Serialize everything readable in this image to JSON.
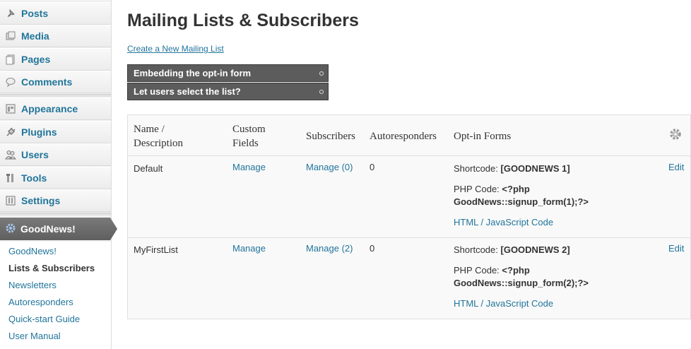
{
  "sidebar": {
    "items": [
      {
        "label": "Posts",
        "icon": "pin-icon"
      },
      {
        "label": "Media",
        "icon": "media-icon"
      },
      {
        "label": "Pages",
        "icon": "pages-icon"
      },
      {
        "label": "Comments",
        "icon": "comments-icon"
      },
      {
        "label": "Appearance",
        "icon": "appearance-icon"
      },
      {
        "label": "Plugins",
        "icon": "plugins-icon"
      },
      {
        "label": "Users",
        "icon": "users-icon"
      },
      {
        "label": "Tools",
        "icon": "tools-icon"
      },
      {
        "label": "Settings",
        "icon": "settings-icon"
      }
    ],
    "active": {
      "label": "GoodNews!",
      "icon": "goodnews-gear-icon"
    },
    "submenu": [
      "GoodNews!",
      "Lists & Subscribers",
      "Newsletters",
      "Autoresponders",
      "Quick-start Guide",
      "User Manual"
    ],
    "current_sub": "Lists & Subscribers"
  },
  "page": {
    "title": "Mailing Lists & Subscribers",
    "create_link": "Create a New Mailing List",
    "help_boxes": [
      "Embedding the opt-in form",
      "Let users select the list?"
    ]
  },
  "table": {
    "headers": {
      "name": [
        "Name /",
        "Description"
      ],
      "fields": [
        "Custom",
        "Fields"
      ],
      "subscribers": "Subscribers",
      "autoresponders": "Autoresponders",
      "optin": "Opt-in Forms"
    },
    "rows": [
      {
        "name": "Default",
        "fields": "Manage",
        "subscribers": "Manage (0)",
        "autoresponders": "0",
        "shortcode_label": "Shortcode:",
        "shortcode": "[GOODNEWS 1]",
        "php_label": "PHP Code:",
        "php_1": "<?php",
        "php_2": "GoodNews::signup_form(1);?>",
        "html_link": "HTML / JavaScript Code",
        "edit": "Edit"
      },
      {
        "name": "MyFirstList",
        "fields": "Manage",
        "subscribers": "Manage (2)",
        "autoresponders": "0",
        "shortcode_label": "Shortcode:",
        "shortcode": "[GOODNEWS 2]",
        "php_label": "PHP Code:",
        "php_1": "<?php",
        "php_2": "GoodNews::signup_form(2);?>",
        "html_link": "HTML / JavaScript Code",
        "edit": "Edit"
      }
    ]
  },
  "colors": {
    "link": "#21759b",
    "active_menu": "#6d6d6d",
    "help_box": "#5c5c5c"
  }
}
